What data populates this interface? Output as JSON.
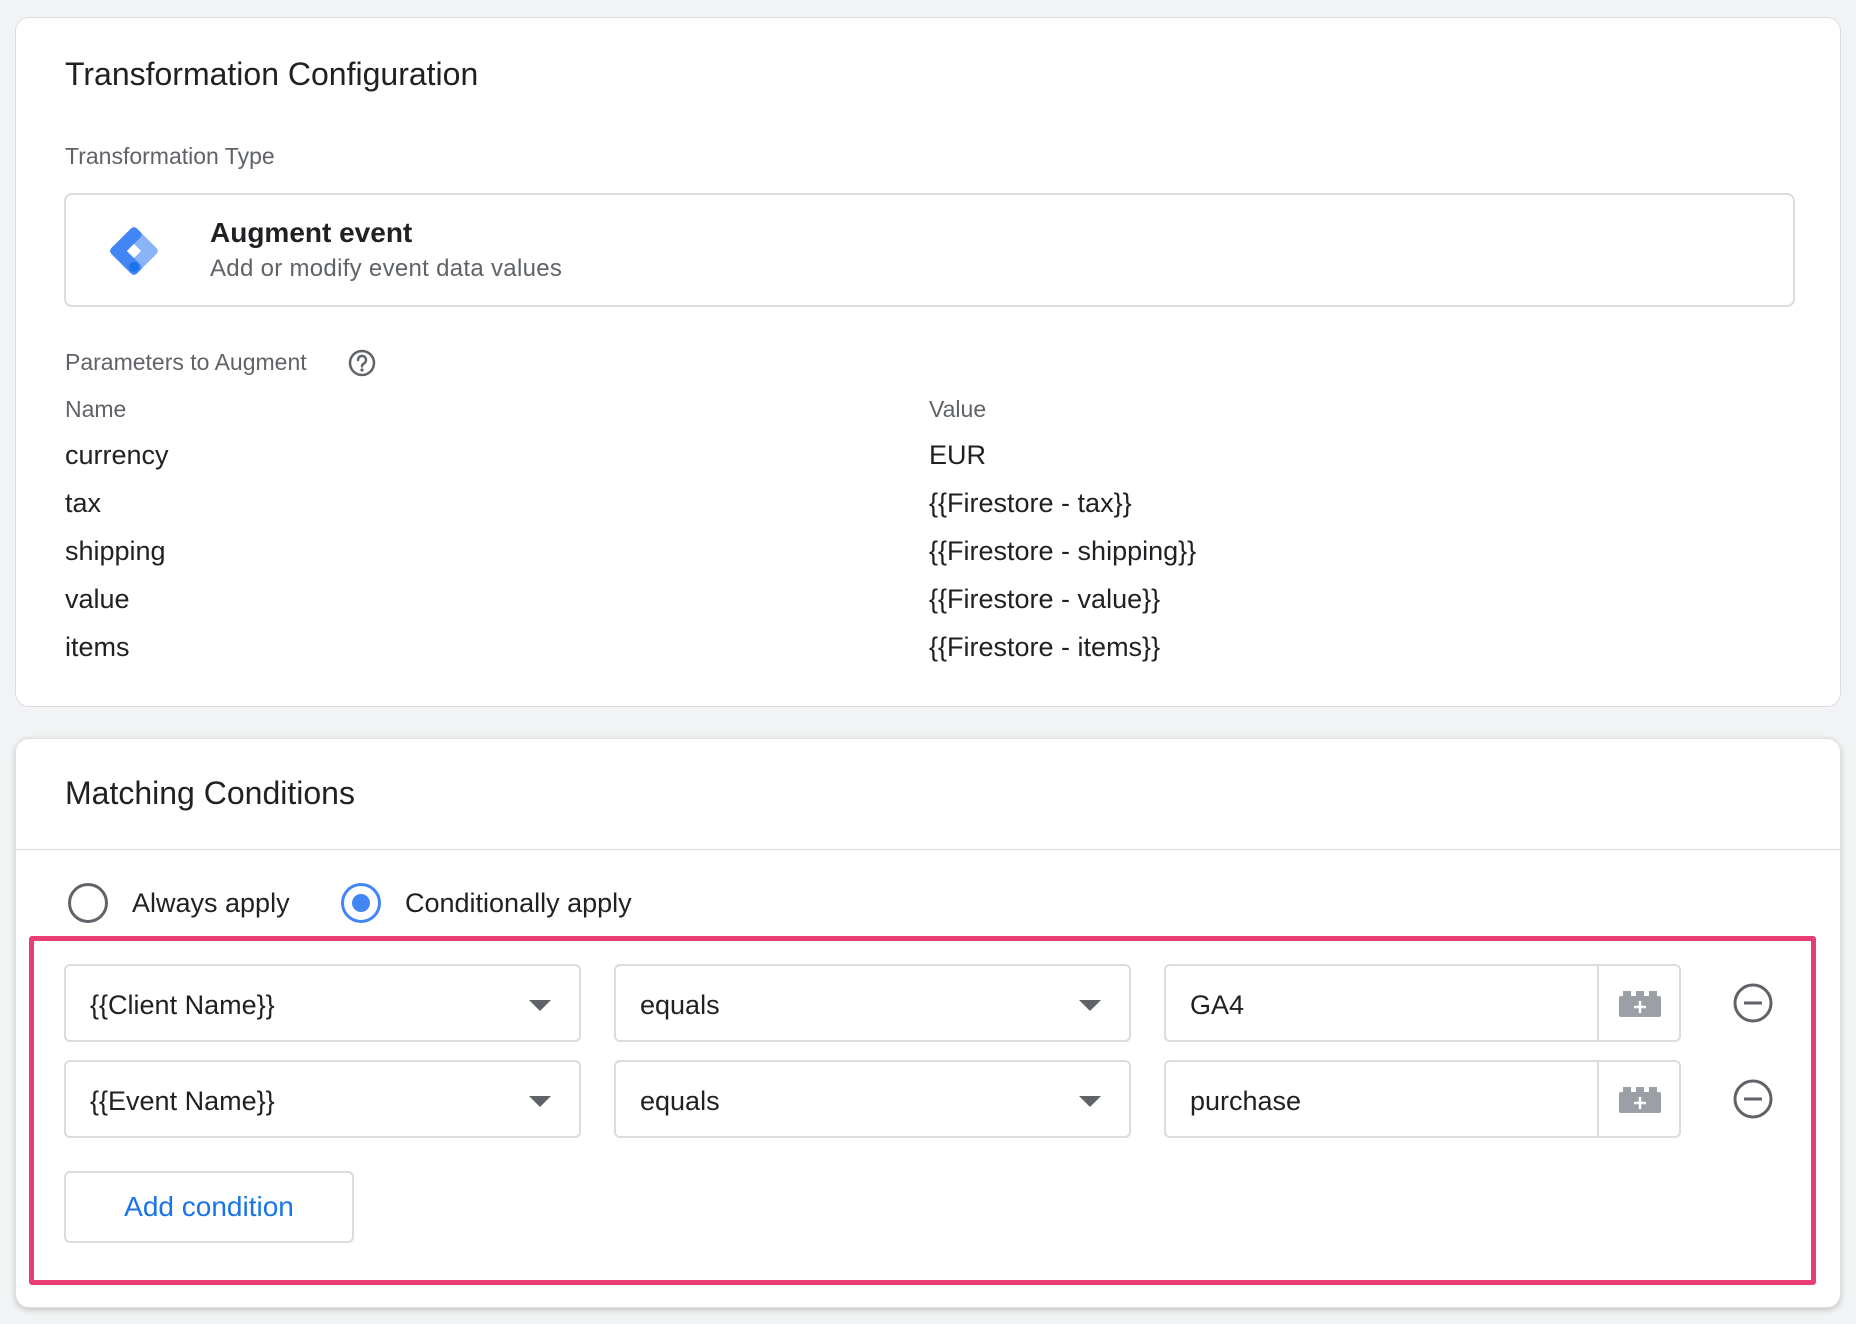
{
  "transformation": {
    "title": "Transformation Configuration",
    "type_label": "Transformation Type",
    "type": {
      "name": "Augment event",
      "description": "Add or modify event data values",
      "icon": "tag-manager-icon"
    },
    "params_label": "Parameters to Augment",
    "columns": {
      "name": "Name",
      "value": "Value"
    },
    "params": [
      {
        "name": "currency",
        "value": "EUR"
      },
      {
        "name": "tax",
        "value": "{{Firestore - tax}}"
      },
      {
        "name": "shipping",
        "value": "{{Firestore - shipping}}"
      },
      {
        "name": "value",
        "value": "{{Firestore - value}}"
      },
      {
        "name": "items",
        "value": "{{Firestore - items}}"
      }
    ]
  },
  "matching": {
    "title": "Matching Conditions",
    "options": [
      {
        "label": "Always apply",
        "selected": false
      },
      {
        "label": "Conditionally apply",
        "selected": true
      }
    ],
    "conditions": [
      {
        "variable": "{{Client Name}}",
        "operator": "equals",
        "value": "GA4"
      },
      {
        "variable": "{{Event Name}}",
        "operator": "equals",
        "value": "purchase"
      }
    ],
    "add_label": "Add condition"
  },
  "colors": {
    "accent": "#1a73e8",
    "radio_selected": "#4285f4",
    "highlight": "#e83e73"
  }
}
